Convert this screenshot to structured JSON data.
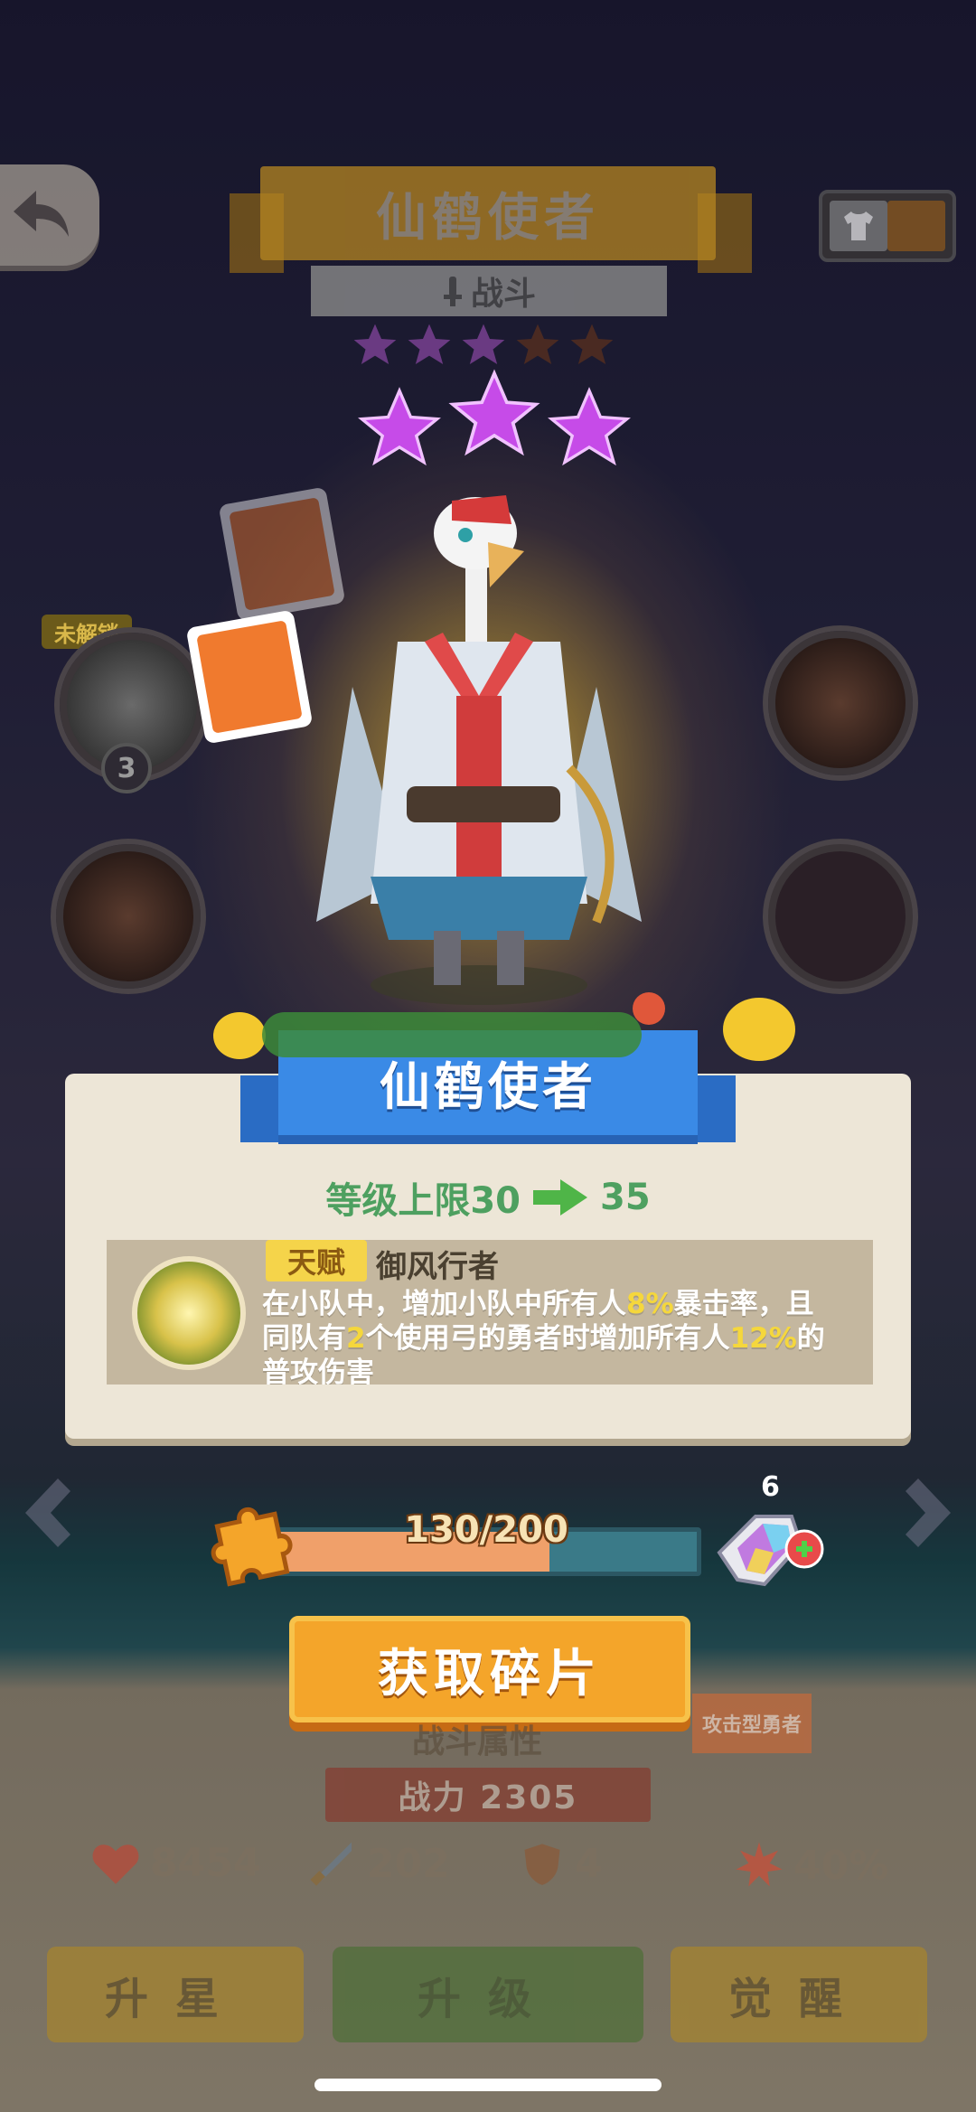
{
  "hero": {
    "name_top": "仙鹤使者",
    "class_label": "战斗",
    "stars_total": 5,
    "stars_filled": 3,
    "big_stars": 3
  },
  "skills": {
    "locked_tag": "未解锁",
    "locked_count": "3"
  },
  "card": {
    "banner_name": "仙鹤使者",
    "level_cap_label": "等级上限30",
    "level_cap_new": "35",
    "talent_tag": "天赋",
    "talent_name": "御风行者",
    "desc_part1": "在小队中，增加小队中所有人",
    "desc_hl1": "8%",
    "desc_part2": "暴击率，且同队有",
    "desc_hl2": "2",
    "desc_part3": "个使用弓的勇者时增加所有人",
    "desc_hl3": "12%",
    "desc_part4": "的普攻伤害"
  },
  "fragments": {
    "current": 130,
    "required": 200,
    "progress_text": "130/200",
    "progress_fraction": 0.65,
    "universal_count": "6",
    "get_button": "获取碎片"
  },
  "stats": {
    "section_title": "战斗属性",
    "type_tag": "攻击型勇者",
    "power_label": "战力 2305",
    "hp": "8454",
    "attack": "202",
    "defense": "4",
    "crit": "40%"
  },
  "actions": {
    "star_up": "升星",
    "level_up": "升级",
    "awaken": "觉醒"
  },
  "colors": {
    "card_bg": "#ede6d7",
    "banner_blue": "#3a8ae6",
    "highlight_yellow": "#f5d73c",
    "level_green": "#4ea060",
    "button_orange": "#f4a52a"
  }
}
